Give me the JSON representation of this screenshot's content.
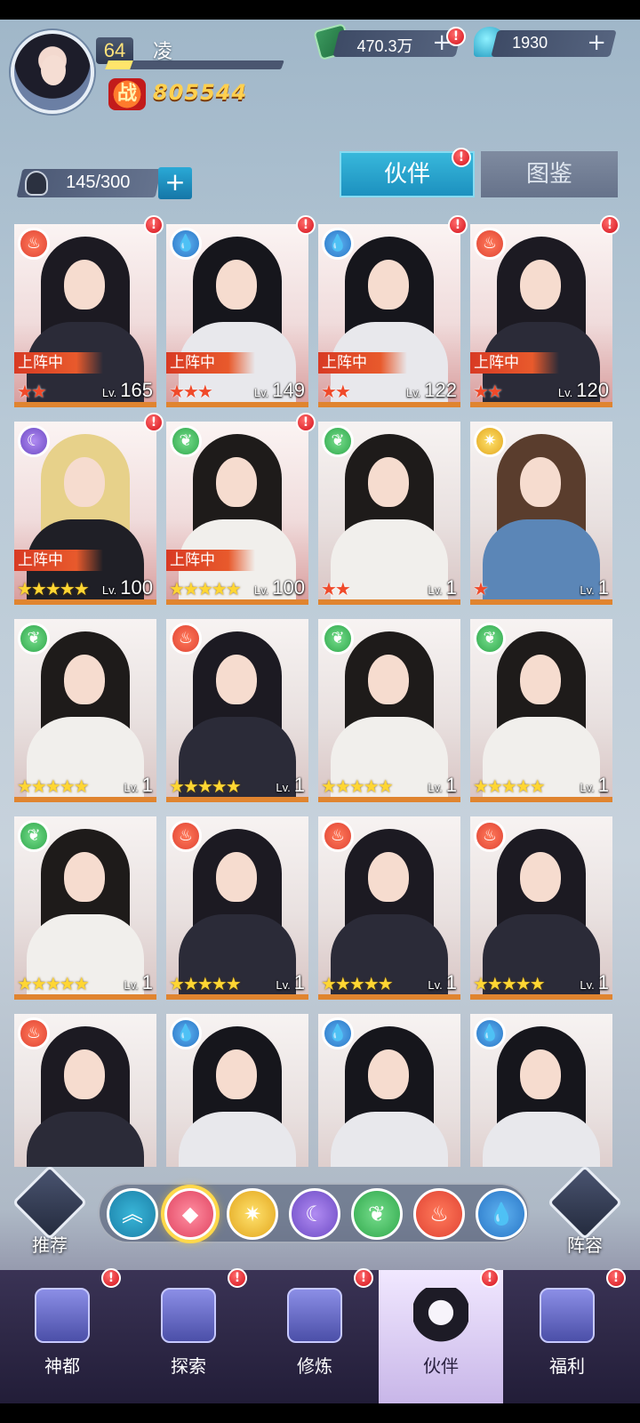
{
  "header": {
    "player_level": "64",
    "player_name": "凌",
    "power_icon_text": "战",
    "power_value": "805544",
    "level_progress": 0.14
  },
  "currencies": [
    {
      "icon": "cash-icon",
      "value": "470.3万",
      "plus": "+"
    },
    {
      "icon": "gem-drop-icon",
      "value": "1930",
      "plus": "+"
    }
  ],
  "roster": {
    "count": "145/300",
    "add_label": "+"
  },
  "tabs": [
    {
      "label": "伙伴",
      "active": true
    },
    {
      "label": "图鉴",
      "active": false
    }
  ],
  "common": {
    "deploy_label": "上阵中",
    "lv_prefix": "Lv.",
    "badge": "!"
  },
  "cards": [
    {
      "element": "fire",
      "deployed": true,
      "stars": "★★",
      "star_color": "red",
      "level": "165",
      "badge": true
    },
    {
      "element": "water",
      "deployed": true,
      "stars": "★★★",
      "star_color": "red",
      "level": "149",
      "badge": true
    },
    {
      "element": "water",
      "deployed": true,
      "stars": "★★",
      "star_color": "red",
      "level": "122",
      "badge": true
    },
    {
      "element": "fire",
      "deployed": true,
      "stars": "★★",
      "star_color": "red",
      "level": "120",
      "badge": true
    },
    {
      "element": "moon",
      "deployed": true,
      "stars": "★★★★★",
      "star_color": "gold",
      "level": "100",
      "badge": true
    },
    {
      "element": "wind",
      "deployed": true,
      "stars": "★★★★★",
      "star_color": "gold",
      "level": "100",
      "badge": true
    },
    {
      "element": "wind",
      "deployed": false,
      "stars": "★★",
      "star_color": "red",
      "level": "1",
      "badge": false
    },
    {
      "element": "sun",
      "deployed": false,
      "stars": "★",
      "star_color": "red",
      "level": "1",
      "badge": false
    },
    {
      "element": "wind",
      "deployed": false,
      "stars": "★★★★★",
      "star_color": "gold",
      "level": "1",
      "badge": false
    },
    {
      "element": "fire",
      "deployed": false,
      "stars": "★★★★★",
      "star_color": "gold",
      "level": "1",
      "badge": false
    },
    {
      "element": "wind",
      "deployed": false,
      "stars": "★★★★★",
      "star_color": "gold",
      "level": "1",
      "badge": false
    },
    {
      "element": "wind",
      "deployed": false,
      "stars": "★★★★★",
      "star_color": "gold",
      "level": "1",
      "badge": false
    },
    {
      "element": "wind",
      "deployed": false,
      "stars": "★★★★★",
      "star_color": "gold",
      "level": "1",
      "badge": false
    },
    {
      "element": "fire",
      "deployed": false,
      "stars": "★★★★★",
      "star_color": "gold",
      "level": "1",
      "badge": false
    },
    {
      "element": "fire",
      "deployed": false,
      "stars": "★★★★★",
      "star_color": "gold",
      "level": "1",
      "badge": false
    },
    {
      "element": "fire",
      "deployed": false,
      "stars": "★★★★★",
      "star_color": "gold",
      "level": "1",
      "badge": false
    },
    {
      "element": "fire",
      "deployed": false,
      "stars": "",
      "star_color": "gold",
      "level": "",
      "badge": false
    },
    {
      "element": "water",
      "deployed": false,
      "stars": "",
      "star_color": "gold",
      "level": "",
      "badge": false
    },
    {
      "element": "water",
      "deployed": false,
      "stars": "",
      "star_color": "gold",
      "level": "",
      "badge": false
    },
    {
      "element": "water",
      "deployed": false,
      "stars": "",
      "star_color": "gold",
      "level": "",
      "badge": false
    }
  ],
  "filter": {
    "left_label": "推荐",
    "right_label": "阵容",
    "elements": [
      "all",
      "special",
      "sun",
      "moon",
      "wind",
      "fire",
      "water"
    ],
    "selected": "special"
  },
  "nav": [
    {
      "label": "神都",
      "icon": "city-icon",
      "badge": true
    },
    {
      "label": "探索",
      "icon": "portal-icon",
      "badge": true
    },
    {
      "label": "修炼",
      "icon": "sword-icon",
      "badge": true
    },
    {
      "label": "伙伴",
      "icon": "hood-icon",
      "badge": true,
      "active": true
    },
    {
      "label": "福利",
      "icon": "gift-icon",
      "badge": true
    }
  ],
  "colors": {
    "accent": "#1b8fbe",
    "fire": "#e04333",
    "water": "#2875c6",
    "wind": "#2fa74b",
    "moon": "#6c4ac4",
    "sun": "#e2a51c",
    "badge": "#d4121c"
  }
}
